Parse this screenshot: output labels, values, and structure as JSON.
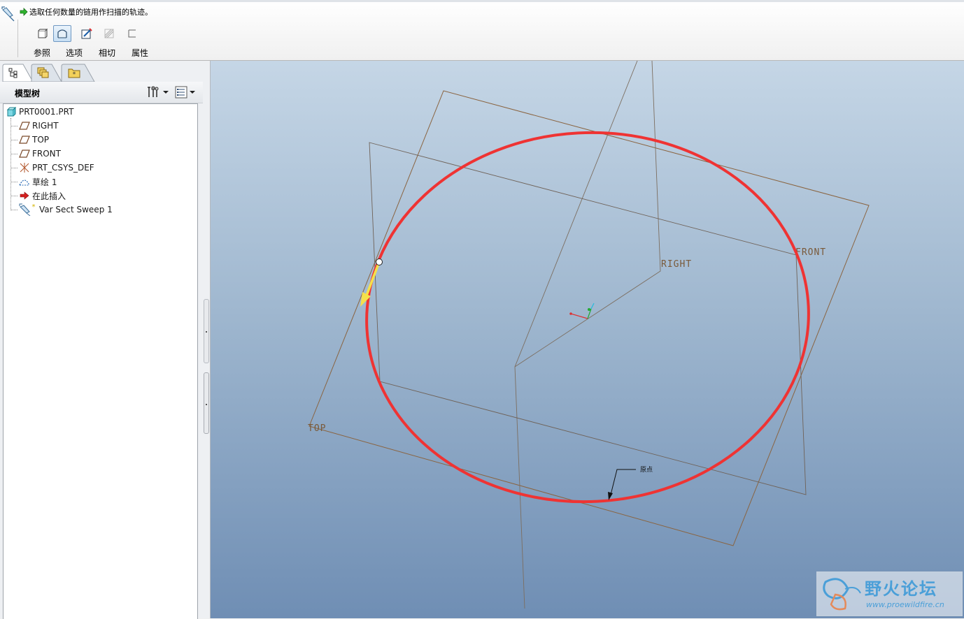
{
  "dashboard": {
    "prompt": "选取任何数量的链用作扫描的轨迹。",
    "tabs": [
      {
        "label": "参照",
        "icon": "reference-icon"
      },
      {
        "label": "选项",
        "icon": "options-icon"
      },
      {
        "label": "相切",
        "icon": "tangency-icon"
      },
      {
        "label": "属性",
        "icon": "properties-icon"
      }
    ]
  },
  "left_panel": {
    "nav_tabs": [
      "model-tree-tab",
      "layers-tab",
      "favorites-tab"
    ],
    "tree_title": "模型树",
    "tree": {
      "root": "PRT0001.PRT",
      "items": [
        {
          "label": "RIGHT",
          "icon": "datum-plane-icon"
        },
        {
          "label": "TOP",
          "icon": "datum-plane-icon"
        },
        {
          "label": "FRONT",
          "icon": "datum-plane-icon"
        },
        {
          "label": "PRT_CSYS_DEF",
          "icon": "csys-icon"
        },
        {
          "label": "草绘 1",
          "icon": "sketch-icon"
        },
        {
          "label": "在此插入",
          "icon": "insert-here-icon"
        },
        {
          "label": "Var Sect Sweep 1",
          "icon": "var-sect-sweep-icon"
        }
      ]
    }
  },
  "graphics": {
    "plane_labels": {
      "right": "RIGHT",
      "front": "FRONT",
      "top": "TOP"
    },
    "start_point_label": "原点",
    "colors": {
      "trajectory": "#ef3333",
      "plane_edges": "#8a6440",
      "direction_arrow": "#f5e04a"
    }
  },
  "watermark": {
    "title": "野火论坛",
    "url": "www.proewildfire.cn"
  }
}
